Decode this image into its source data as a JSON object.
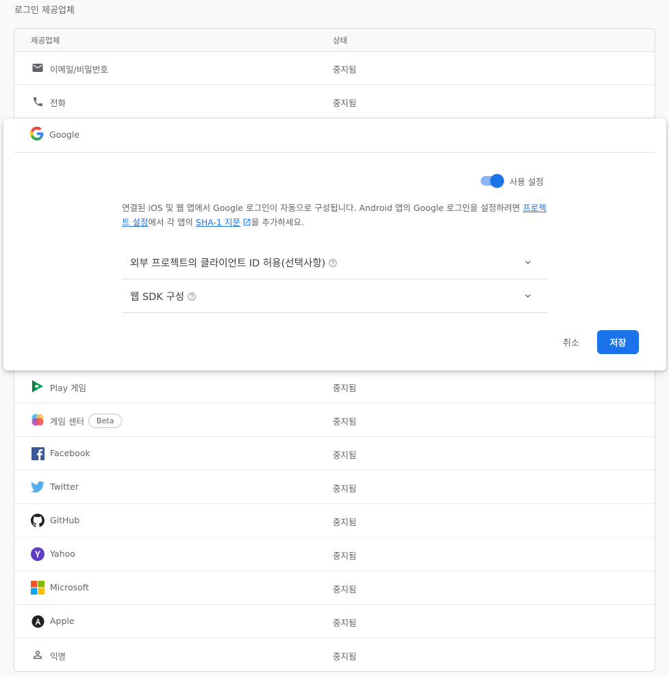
{
  "section_title": "로그인 제공업체",
  "table": {
    "col_provider": "제공업체",
    "col_status": "상태"
  },
  "rows_top": [
    {
      "name": "이메일/비밀번호",
      "status": "중지됨",
      "icon": "email-icon"
    },
    {
      "name": "전화",
      "status": "중지됨",
      "icon": "phone-icon"
    }
  ],
  "google_panel": {
    "name": "Google",
    "icon": "google-icon",
    "toggle_label": "사용 설정",
    "toggle_on": true,
    "desc_part1": "연결된 iOS 및 웹 앱에서 Google 로그인이 자동으로 구성됩니다. Android 앱의 Google 로그인을 설정하려면 ",
    "desc_link1": "프로젝트 설정",
    "desc_part2": "에서 각 앱의 ",
    "desc_link2": "SHA-1 지문",
    "desc_part3": "을 추가하세요.",
    "expander1": "외부 프로젝트의 클라이언트 ID 허용(선택사항)",
    "expander2": "웹 SDK 구성",
    "cancel": "취소",
    "save": "저장"
  },
  "rows_bottom": [
    {
      "name": "Play 게임",
      "status": "중지됨",
      "icon": "play-games-icon"
    },
    {
      "name": "게임 센터",
      "status": "중지됨",
      "icon": "game-center-icon",
      "badge": "Beta"
    },
    {
      "name": "Facebook",
      "status": "중지됨",
      "icon": "facebook-icon"
    },
    {
      "name": "Twitter",
      "status": "중지됨",
      "icon": "twitter-icon"
    },
    {
      "name": "GitHub",
      "status": "중지됨",
      "icon": "github-icon"
    },
    {
      "name": "Yahoo",
      "status": "중지됨",
      "icon": "yahoo-icon"
    },
    {
      "name": "Microsoft",
      "status": "중지됨",
      "icon": "microsoft-icon"
    },
    {
      "name": "Apple",
      "status": "중지됨",
      "icon": "apple-icon"
    },
    {
      "name": "익명",
      "status": "중지됨",
      "icon": "anonymous-icon"
    }
  ],
  "colors": {
    "accent": "#1a73e8",
    "toggle_track": "#8ab4f8",
    "text_secondary": "#5f6368"
  }
}
